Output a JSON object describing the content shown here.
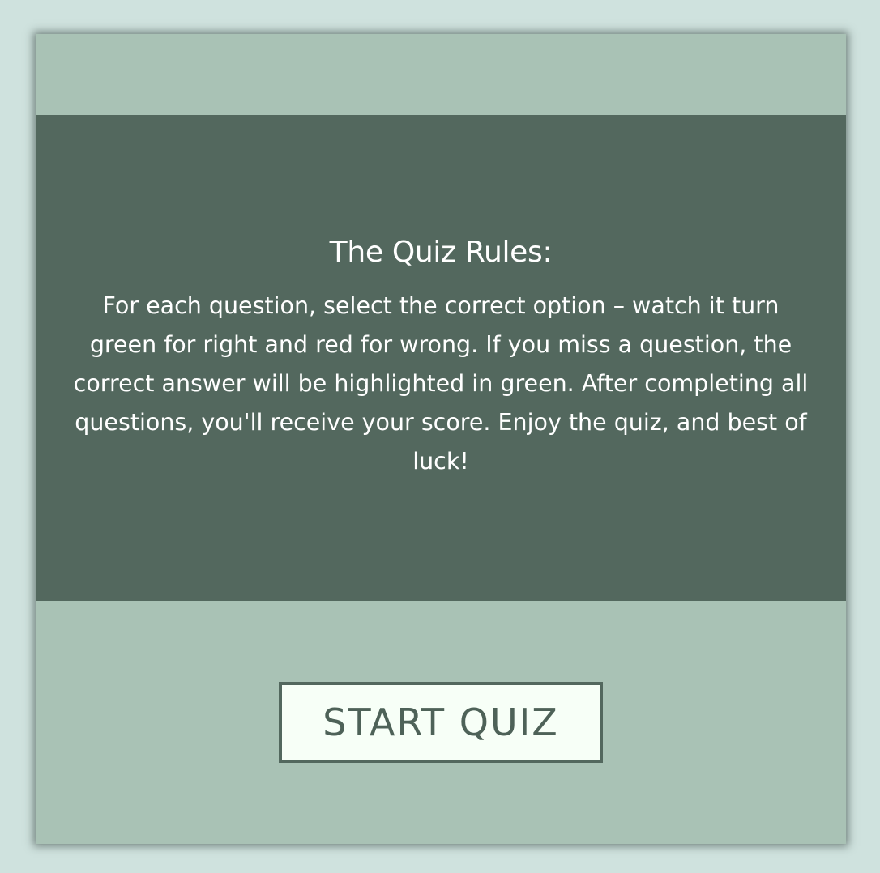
{
  "rules": {
    "title": "The Quiz Rules:",
    "text": "For each question, select the correct option – watch it turn green for right and red for wrong. If you miss a question, the correct answer will be highlighted in green. After completing all questions, you'll receive your score. Enjoy the quiz, and best of luck!"
  },
  "start_button": {
    "label": "START QUIZ"
  },
  "colors": {
    "page_background": "#cfe2de",
    "card_background": "#a9c2b5",
    "panel_background": "#53685e",
    "button_background": "#f7fff7",
    "button_text": "#4e6258"
  }
}
